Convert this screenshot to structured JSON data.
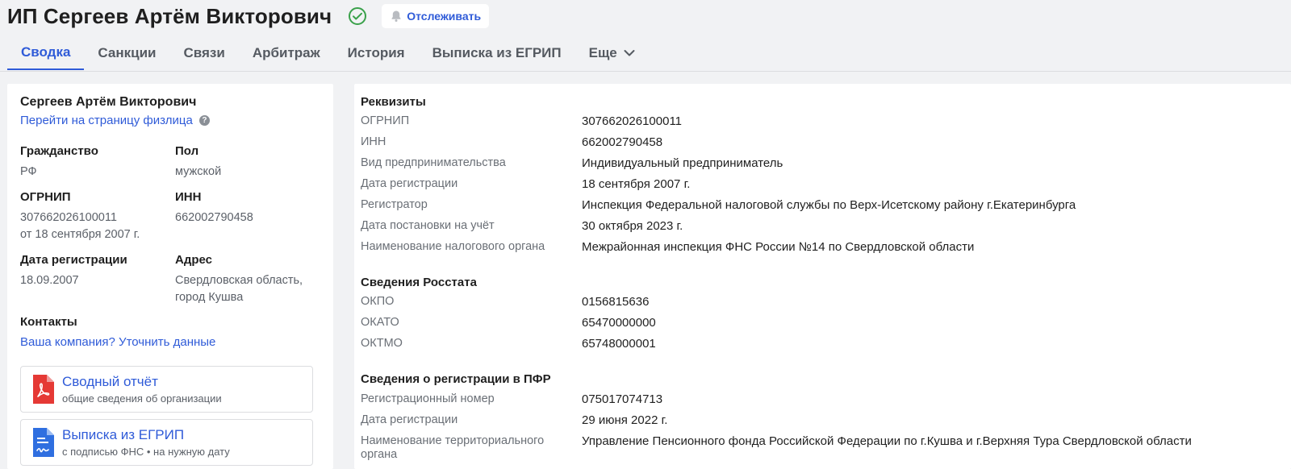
{
  "header": {
    "title": "ИП Сергеев Артём Викторович",
    "follow_label": "Отслеживать"
  },
  "tabs": [
    {
      "label": "Сводка",
      "active": true
    },
    {
      "label": "Санкции"
    },
    {
      "label": "Связи"
    },
    {
      "label": "Арбитраж"
    },
    {
      "label": "История"
    },
    {
      "label": "Выписка из ЕГРИП"
    },
    {
      "label": "Еще"
    }
  ],
  "left": {
    "name": "Сергеев Артём Викторович",
    "person_link": "Перейти на страницу физлица",
    "citizenship_label": "Гражданство",
    "citizenship_value": "РФ",
    "sex_label": "Пол",
    "sex_value": "мужской",
    "ogrnip_label": "ОГРНИП",
    "ogrnip_value": "307662026100011",
    "ogrnip_date": "от 18 сентября 2007 г.",
    "inn_label": "ИНН",
    "inn_value": "662002790458",
    "reg_date_label": "Дата регистрации",
    "reg_date_value": "18.09.2007",
    "address_label": "Адрес",
    "address_line1": "Свердловская область,",
    "address_line2": "город Кушва",
    "contacts_label": "Контакты",
    "contacts_link": "Ваша компания? Уточнить данные",
    "doc1_title": "Сводный отчёт",
    "doc1_sub": "общие сведения об организации",
    "doc2_title": "Выписка из ЕГРИП",
    "doc2_sub": "с подписью ФНС • на нужную дату"
  },
  "right": {
    "requisites_title": "Реквизиты",
    "requisites": [
      {
        "k": "ОГРНИП",
        "v": "307662026100011"
      },
      {
        "k": "ИНН",
        "v": "662002790458"
      },
      {
        "k": "Вид предпринимательства",
        "v": "Индивидуальный предприниматель"
      },
      {
        "k": "Дата регистрации",
        "v": "18 сентября 2007 г."
      },
      {
        "k": "Регистратор",
        "v": "Инспекция Федеральной налоговой службы по Верх-Исетскому району г.Екатеринбурга"
      },
      {
        "k": "Дата постановки на учёт",
        "v": "30 октября 2023 г."
      },
      {
        "k": "Наименование налогового органа",
        "v": "Межрайонная инспекция ФНС России №14 по Свердловской области"
      }
    ],
    "rosstat_title": "Сведения Росстата",
    "rosstat": [
      {
        "k": "ОКПО",
        "v": "0156815636"
      },
      {
        "k": "ОКАТО",
        "v": "65470000000"
      },
      {
        "k": "ОКТМО",
        "v": "65748000001"
      }
    ],
    "pfr_title": "Сведения о регистрации в ПФР",
    "pfr": [
      {
        "k": "Регистрационный номер",
        "v": "075017074713"
      },
      {
        "k": "Дата регистрации",
        "v": "29 июня 2022 г."
      },
      {
        "k": "Наименование территориального органа",
        "v": "Управление Пенсионного фонда Российской Федерации по г.Кушва и г.Верхняя Тура Свердловской области"
      }
    ]
  }
}
